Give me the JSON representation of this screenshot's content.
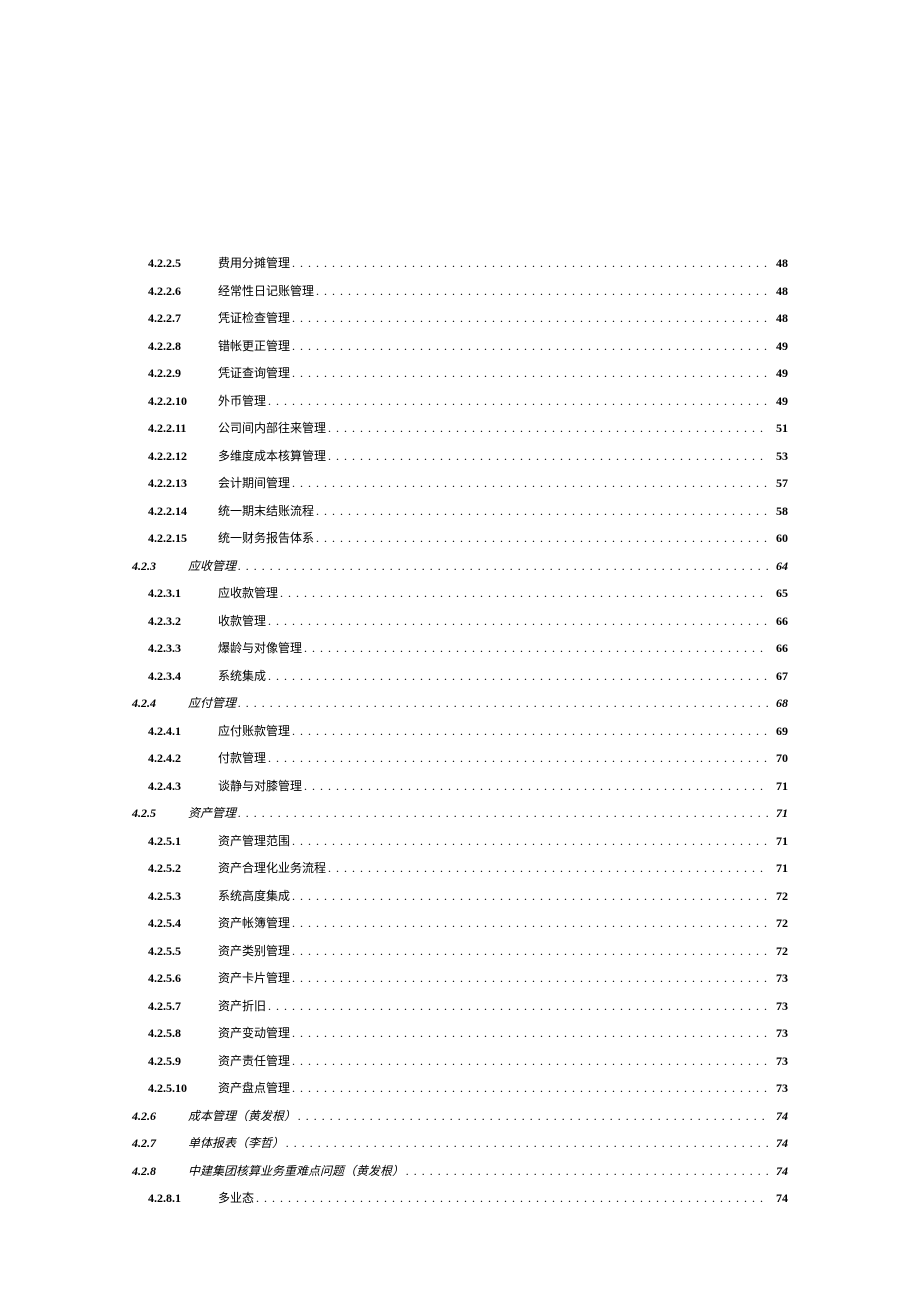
{
  "entries": [
    {
      "level": 3,
      "num": "4.2.2.5",
      "title": "费用分摊管理",
      "page": "48",
      "italic": false
    },
    {
      "level": 3,
      "num": "4.2.2.6",
      "title": "经常性日记账管理",
      "page": "48",
      "italic": false
    },
    {
      "level": 3,
      "num": "4.2.2.7",
      "title": "凭证检查管理",
      "page": "48",
      "italic": false
    },
    {
      "level": 3,
      "num": "4.2.2.8",
      "title": "错帐更正管理",
      "page": "49",
      "italic": false
    },
    {
      "level": 3,
      "num": "4.2.2.9",
      "title": "凭证查询管理",
      "page": "49",
      "italic": false
    },
    {
      "level": 3,
      "num": "4.2.2.10",
      "title": "外币管理",
      "page": "49",
      "italic": false
    },
    {
      "level": 3,
      "num": "4.2.2.11",
      "title": "公司间内部往来管理",
      "page": "51",
      "italic": false
    },
    {
      "level": 3,
      "num": "4.2.2.12",
      "title": "多维度成本核算管理",
      "page": "53",
      "italic": false
    },
    {
      "level": 3,
      "num": "4.2.2.13",
      "title": "会计期间管理",
      "page": "57",
      "italic": false
    },
    {
      "level": 3,
      "num": "4.2.2.14",
      "title": "统一期末结账流程",
      "page": "58",
      "italic": false
    },
    {
      "level": 3,
      "num": "4.2.2.15",
      "title": "统一财务报告体系",
      "page": "60",
      "italic": false
    },
    {
      "level": 2,
      "num": "4.2.3",
      "title": "应收管理",
      "page": "64",
      "italic": true
    },
    {
      "level": 3,
      "num": "4.2.3.1",
      "title": "应收款管理",
      "page": "65",
      "italic": false
    },
    {
      "level": 3,
      "num": "4.2.3.2",
      "title": "收款管理",
      "page": "66",
      "italic": false
    },
    {
      "level": 3,
      "num": "4.2.3.3",
      "title": "爆龄与对像管理",
      "page": "66",
      "italic": false
    },
    {
      "level": 3,
      "num": "4.2.3.4",
      "title": "系统集成",
      "page": "67",
      "italic": false
    },
    {
      "level": 2,
      "num": "4.2.4",
      "title": "应付管理",
      "page": "68",
      "italic": true
    },
    {
      "level": 3,
      "num": "4.2.4.1",
      "title": "应付账款管理",
      "page": "69",
      "italic": false
    },
    {
      "level": 3,
      "num": "4.2.4.2",
      "title": "付款管理",
      "page": "70",
      "italic": false
    },
    {
      "level": 3,
      "num": "4.2.4.3",
      "title": "谈静与对膝管理",
      "page": "71",
      "italic": false
    },
    {
      "level": 2,
      "num": "4.2.5",
      "title": "资产管理",
      "page": "71",
      "italic": true
    },
    {
      "level": 3,
      "num": "4.2.5.1",
      "title": "资产管理范围",
      "page": "71",
      "italic": false
    },
    {
      "level": 3,
      "num": "4.2.5.2",
      "title": "资产合理化业务流程",
      "page": "71",
      "italic": false
    },
    {
      "level": 3,
      "num": "4.2.5.3",
      "title": "系统高度集成",
      "page": "72",
      "italic": false
    },
    {
      "level": 3,
      "num": "4.2.5.4",
      "title": "资产帐簿管理",
      "page": "72",
      "italic": false
    },
    {
      "level": 3,
      "num": "4.2.5.5",
      "title": "资产类别管理",
      "page": "72",
      "italic": false
    },
    {
      "level": 3,
      "num": "4.2.5.6",
      "title": "资产卡片管理",
      "page": "73",
      "italic": false
    },
    {
      "level": 3,
      "num": "4.2.5.7",
      "title": "资产折旧",
      "page": "73",
      "italic": false
    },
    {
      "level": 3,
      "num": "4.2.5.8",
      "title": "资产变动管理",
      "page": "73",
      "italic": false
    },
    {
      "level": 3,
      "num": "4.2.5.9",
      "title": "资产责任管理",
      "page": "73",
      "italic": false
    },
    {
      "level": 3,
      "num": "4.2.5.10",
      "title": "资产盘点管理",
      "page": "73",
      "italic": false
    },
    {
      "level": 2,
      "num": "4.2.6",
      "title": "成本管理（黄发根）",
      "page": "74",
      "italic": true
    },
    {
      "level": 2,
      "num": "4.2.7",
      "title": "单体报表（李哲）",
      "page": "74",
      "italic": true
    },
    {
      "level": 2,
      "num": "4.2.8",
      "title": "中建集团核算业务重难点问题（黄发根）",
      "page": "74",
      "italic": true
    },
    {
      "level": 3,
      "num": "4.2.8.1",
      "title": "多业态",
      "page": "74",
      "italic": false
    }
  ]
}
